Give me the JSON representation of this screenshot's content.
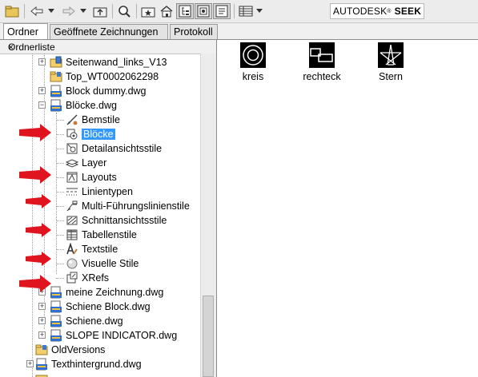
{
  "brand": {
    "name": "AUTODESK",
    "reg": "®",
    "product": "SEEK"
  },
  "toolbar": {
    "icons": [
      "folder-tree-icon",
      "back-icon",
      "back-dropdown-icon",
      "forward-icon",
      "forward-dropdown-icon",
      "up-folder-icon",
      "search-icon",
      "favorites-icon",
      "home-icon",
      "tree-toggle-icon",
      "preview-icon",
      "description-icon",
      "views-icon",
      "views-dropdown-icon"
    ]
  },
  "tabs": [
    {
      "label": "Ordner",
      "active": true
    },
    {
      "label": "Geöffnete Zeichnungen",
      "active": false
    },
    {
      "label": "Protokoll",
      "active": false
    }
  ],
  "panel": {
    "title": "Ordnerliste",
    "close": "×"
  },
  "tree": [
    {
      "label": "Seitenwand_links_V13",
      "icon": "folder-dwg-icon"
    },
    {
      "label": "Top_WT0002062298",
      "icon": "folder-icon"
    },
    {
      "label": "Block dummy.dwg",
      "icon": "dwg-file-icon"
    },
    {
      "label": "Blöcke.dwg",
      "icon": "dwg-file-icon"
    },
    {
      "label": "Bemstile",
      "icon": "dimstyle-icon"
    },
    {
      "label": "Blöcke",
      "icon": "blocks-icon",
      "selected": true
    },
    {
      "label": "Detailansichtsstile",
      "icon": "detailview-icon"
    },
    {
      "label": "Layer",
      "icon": "layer-icon"
    },
    {
      "label": "Layouts",
      "icon": "layout-icon"
    },
    {
      "label": "Linientypen",
      "icon": "linetype-icon"
    },
    {
      "label": "Multi-Führungslinienstile",
      "icon": "mleader-icon"
    },
    {
      "label": "Schnittansichtsstile",
      "icon": "sectionview-icon"
    },
    {
      "label": "Tabellenstile",
      "icon": "tablestyle-icon"
    },
    {
      "label": "Textstile",
      "icon": "textstyle-icon"
    },
    {
      "label": "Visuelle Stile",
      "icon": "visualstyle-icon"
    },
    {
      "label": "XRefs",
      "icon": "xref-icon"
    },
    {
      "label": "meine Zeichnung.dwg",
      "icon": "dwg-file-icon"
    },
    {
      "label": "Schiene Block.dwg",
      "icon": "dwg-file-icon"
    },
    {
      "label": "Schiene.dwg",
      "icon": "dwg-file-icon"
    },
    {
      "label": "SLOPE INDICATOR.dwg",
      "icon": "dwg-file-icon"
    },
    {
      "label": "OldVersions",
      "icon": "folder-icon"
    },
    {
      "label": "Texthintergrund.dwg",
      "icon": "dwg-file-icon"
    }
  ],
  "content": {
    "items": [
      {
        "label": "kreis",
        "icon": "circle-block-icon"
      },
      {
        "label": "rechteck",
        "icon": "rectangle-block-icon"
      },
      {
        "label": "Stern",
        "icon": "star-block-icon"
      }
    ]
  },
  "colors": {
    "selection": "#3399ff",
    "arrow": "#e0141e",
    "icon_bg": "#000000"
  }
}
